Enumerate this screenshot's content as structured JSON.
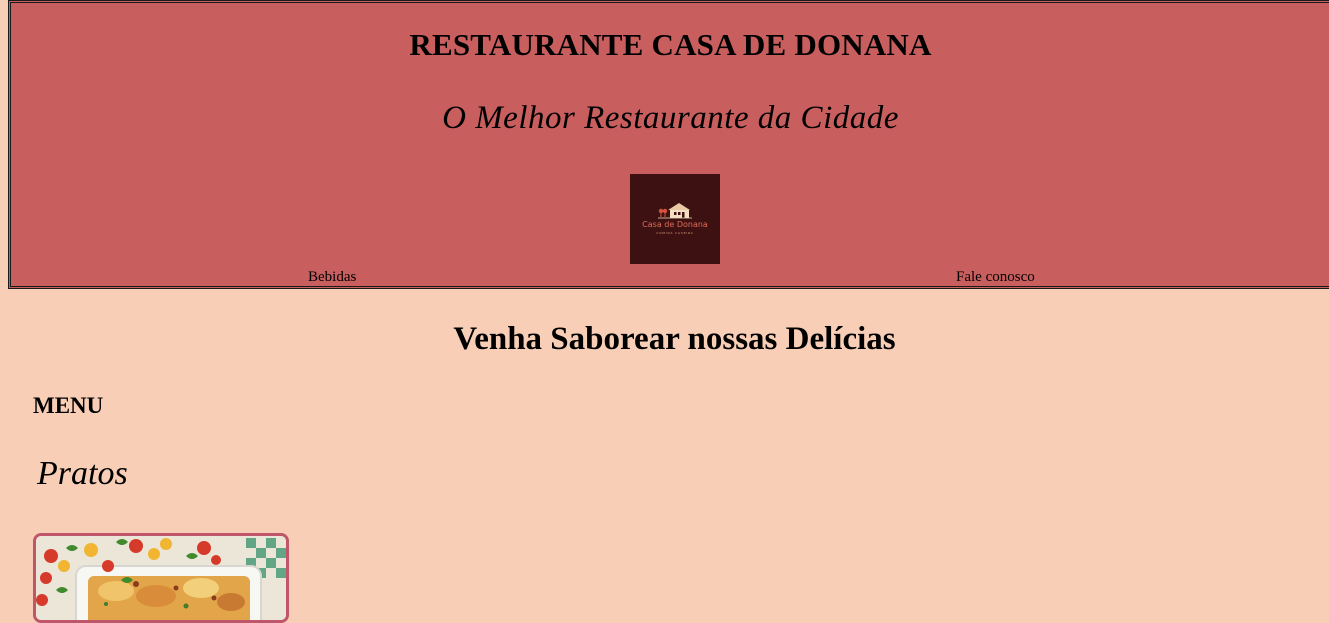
{
  "header": {
    "title": "RESTAURANTE CASA DE DONANA",
    "tagline": "O Melhor Restaurante da Cidade",
    "logo": {
      "name": "Casa de Donana",
      "subtitle": "COMIDA CASEIRA"
    },
    "nav": [
      {
        "label": "Bebidas"
      },
      {
        "label": "Fale conosco"
      }
    ]
  },
  "main": {
    "section_title": "Venha Saborear nossas Delícias",
    "menu_heading": "MENU",
    "category_heading": "Pratos",
    "dish_image": "baked-dish-photo"
  },
  "colors": {
    "page_background": "#f8cfb6",
    "header_background": "#c85e5e",
    "logo_background": "#3d1111",
    "card_border": "#c0566a"
  }
}
